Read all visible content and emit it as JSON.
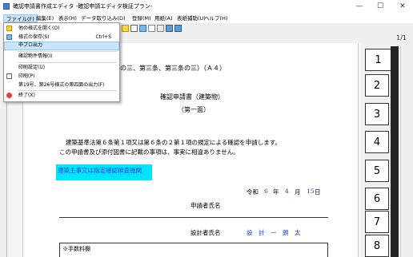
{
  "window": {
    "title": "確認申請書作成エディタ -確認申請エディタ検証プラン-",
    "minimize": "—",
    "maximize": "☐",
    "close": "✕"
  },
  "menubar": {
    "items": [
      {
        "label": "ファイル(F)"
      },
      {
        "label": "編集(E)"
      },
      {
        "label": "表示(H)"
      },
      {
        "label": "データ取り込み(D)"
      },
      {
        "label": "登録(M)"
      },
      {
        "label": "用紙(A)"
      },
      {
        "label": "表紙補助(U)"
      },
      {
        "label": "ヘルプ(H)"
      }
    ]
  },
  "file_menu": {
    "items": [
      {
        "label": "他の様式を開く(O)",
        "shortcut": ""
      },
      {
        "label": "様式の保存(S)",
        "shortcut": "Ctrl+S"
      },
      {
        "label": "申プロ出力",
        "shortcut": ""
      },
      {
        "label": "確認物件情報(I)",
        "shortcut": ""
      },
      {
        "label": "印刷設定(U)",
        "shortcut": ""
      },
      {
        "label": "印刷(P)",
        "shortcut": ""
      },
      {
        "label": "第19号、第26号様式の第四面の出力(F)",
        "shortcut": ""
      },
      {
        "label": "終了(X)",
        "shortcut": ""
      }
    ]
  },
  "toolbar": {
    "page_indicator": "1/1"
  },
  "document": {
    "header_fragment": "の三、第三条、第三条の三）（Ａ４）",
    "title": "確認申請書（建築物）",
    "subtitle": "（第一面）",
    "body_line1": "建築基準法第６条第１項又は第６条の２第１項の規定による確認を申請します。",
    "body_line2": "この申請書及び添付図書に記載の事項は、事実に相違ありません。",
    "highlight_text": "建築主事又は指定確認検査機関",
    "date_era": "令和",
    "date_year": "6",
    "date_year_unit": "年",
    "date_month": "4",
    "date_month_unit": "月",
    "date_day": "15",
    "date_day_unit": "日",
    "applicant_label": "申請者氏名",
    "designer_label": "設計者氏名",
    "designer_name": "設　計　一　朗　太",
    "fee_label": "※手数料欄"
  },
  "page_tabs": [
    "1",
    "2",
    "3",
    "4",
    "5",
    "6",
    "7",
    "8"
  ],
  "colors": {
    "highlight_bg": "#00e5ff",
    "highlight_text": "#1a4dd6",
    "blue_value": "#1a3dd6",
    "menu_hover": "#cce4f7"
  }
}
